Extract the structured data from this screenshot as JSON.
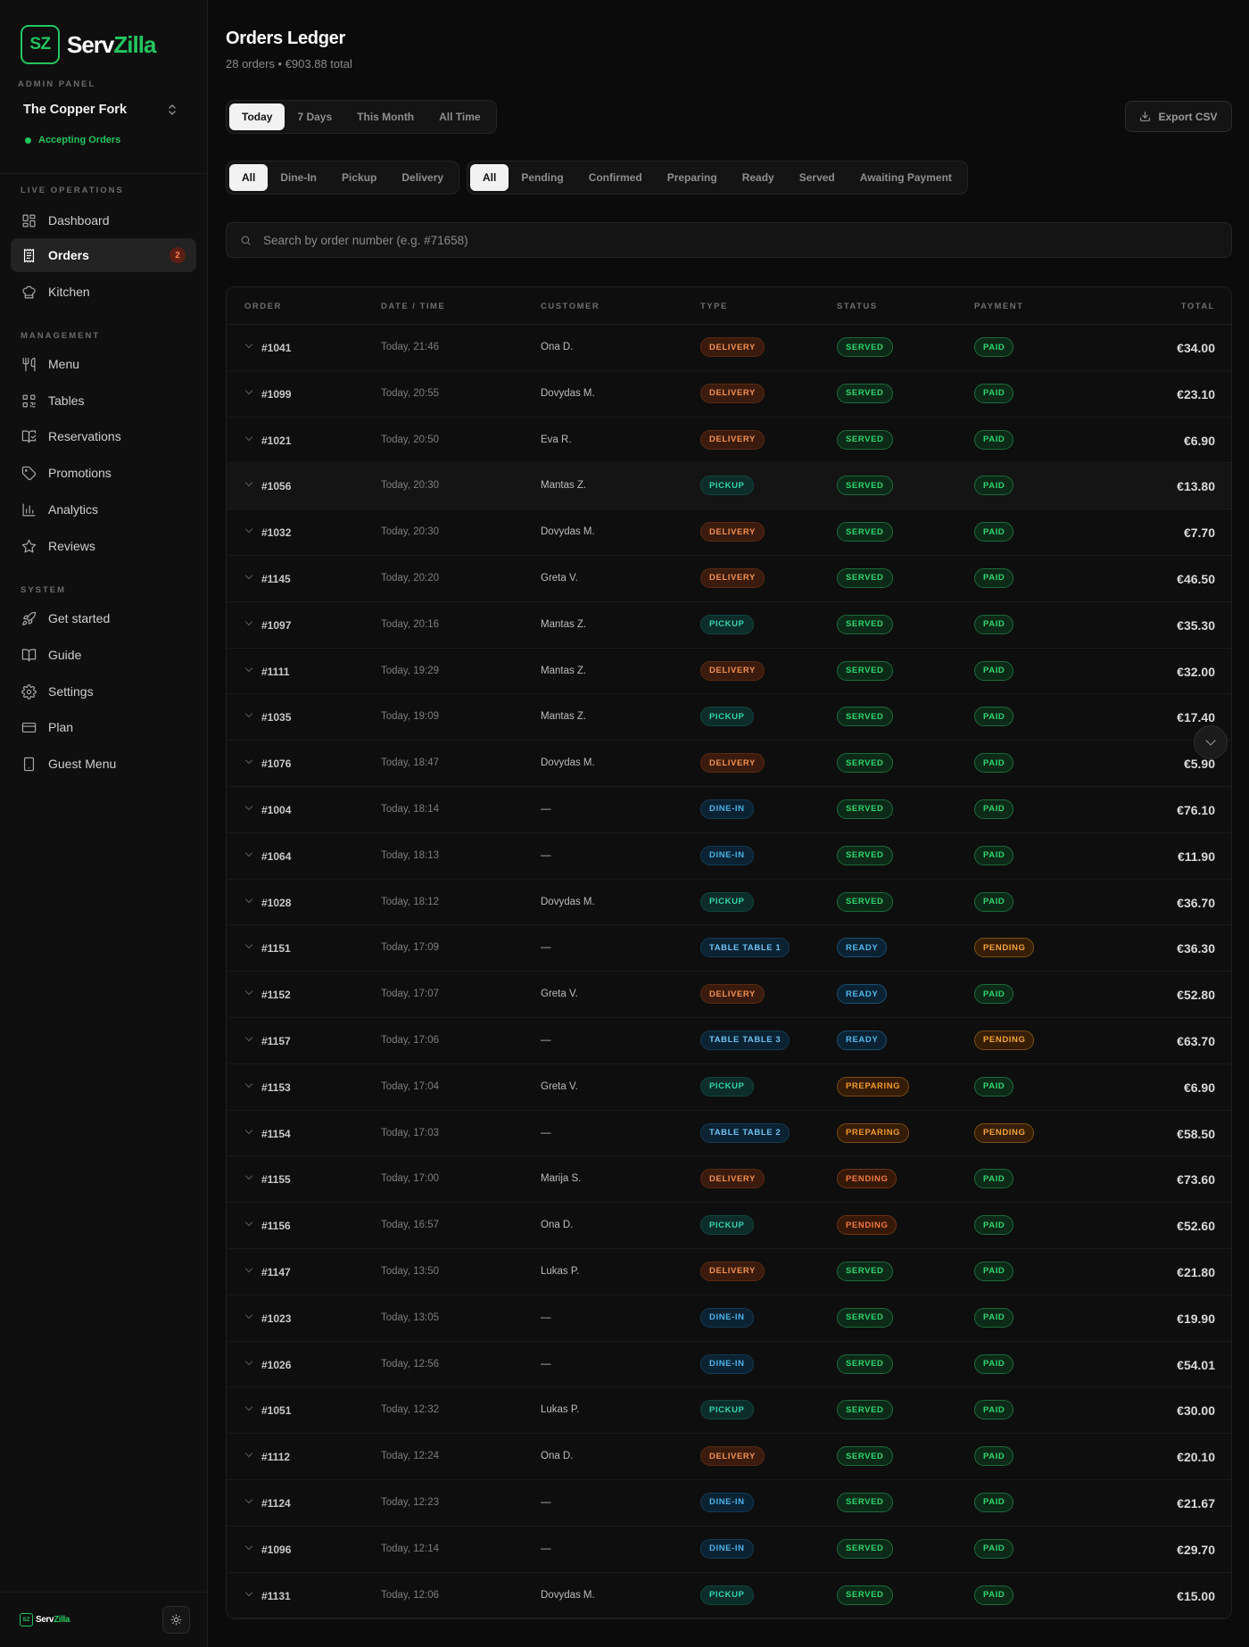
{
  "brand": {
    "mark": "SZ",
    "name_a": "Serv",
    "name_b": "Zilla"
  },
  "sidebar": {
    "admin_label": "ADMIN PANEL",
    "restaurant": "The Copper Fork",
    "status": "Accepting Orders",
    "sections": {
      "live": "LIVE OPERATIONS",
      "management": "MANAGEMENT",
      "system": "SYSTEM"
    },
    "items": {
      "dashboard": "Dashboard",
      "orders": "Orders",
      "orders_badge": "2",
      "kitchen": "Kitchen",
      "menu": "Menu",
      "tables": "Tables",
      "reservations": "Reservations",
      "promotions": "Promotions",
      "analytics": "Analytics",
      "reviews": "Reviews",
      "get_started": "Get started",
      "guide": "Guide",
      "settings": "Settings",
      "plan": "Plan",
      "guest_menu": "Guest Menu"
    }
  },
  "header": {
    "title": "Orders Ledger",
    "subtitle": "28 orders • €903.88 total"
  },
  "filters": {
    "range": [
      "Today",
      "7 Days",
      "This Month",
      "All Time"
    ],
    "range_selected": "Today",
    "type": [
      "All",
      "Dine-In",
      "Pickup",
      "Delivery"
    ],
    "type_selected": "All",
    "status": [
      "All",
      "Pending",
      "Confirmed",
      "Preparing",
      "Ready",
      "Served",
      "Awaiting Payment"
    ],
    "status_selected": "All"
  },
  "export_label": "Export CSV",
  "search": {
    "placeholder": "Search by order number (e.g. #71658)"
  },
  "table": {
    "columns": [
      "ORDER",
      "DATE / TIME",
      "CUSTOMER",
      "TYPE",
      "STATUS",
      "PAYMENT",
      "TOTAL"
    ],
    "rows": [
      {
        "order": "#1041",
        "time": "Today, 21:46",
        "customer": "Ona D.",
        "type": "DELIVERY",
        "status": "SERVED",
        "payment": "PAID",
        "total": "€34.00"
      },
      {
        "order": "#1099",
        "time": "Today, 20:55",
        "customer": "Dovydas M.",
        "type": "DELIVERY",
        "status": "SERVED",
        "payment": "PAID",
        "total": "€23.10"
      },
      {
        "order": "#1021",
        "time": "Today, 20:50",
        "customer": "Eva R.",
        "type": "DELIVERY",
        "status": "SERVED",
        "payment": "PAID",
        "total": "€6.90"
      },
      {
        "order": "#1056",
        "time": "Today, 20:30",
        "customer": "Mantas Z.",
        "type": "PICKUP",
        "status": "SERVED",
        "payment": "PAID",
        "total": "€13.80"
      },
      {
        "order": "#1032",
        "time": "Today, 20:30",
        "customer": "Dovydas M.",
        "type": "DELIVERY",
        "status": "SERVED",
        "payment": "PAID",
        "total": "€7.70"
      },
      {
        "order": "#1145",
        "time": "Today, 20:20",
        "customer": "Greta V.",
        "type": "DELIVERY",
        "status": "SERVED",
        "payment": "PAID",
        "total": "€46.50"
      },
      {
        "order": "#1097",
        "time": "Today, 20:16",
        "customer": "Mantas Z.",
        "type": "PICKUP",
        "status": "SERVED",
        "payment": "PAID",
        "total": "€35.30"
      },
      {
        "order": "#1111",
        "time": "Today, 19:29",
        "customer": "Mantas Z.",
        "type": "DELIVERY",
        "status": "SERVED",
        "payment": "PAID",
        "total": "€32.00"
      },
      {
        "order": "#1035",
        "time": "Today, 19:09",
        "customer": "Mantas Z.",
        "type": "PICKUP",
        "status": "SERVED",
        "payment": "PAID",
        "total": "€17.40"
      },
      {
        "order": "#1076",
        "time": "Today, 18:47",
        "customer": "Dovydas M.",
        "type": "DELIVERY",
        "status": "SERVED",
        "payment": "PAID",
        "total": "€5.90"
      },
      {
        "order": "#1004",
        "time": "Today, 18:14",
        "customer": "—",
        "type": "DINE-IN",
        "status": "SERVED",
        "payment": "PAID",
        "total": "€76.10"
      },
      {
        "order": "#1064",
        "time": "Today, 18:13",
        "customer": "—",
        "type": "DINE-IN",
        "status": "SERVED",
        "payment": "PAID",
        "total": "€11.90"
      },
      {
        "order": "#1028",
        "time": "Today, 18:12",
        "customer": "Dovydas M.",
        "type": "PICKUP",
        "status": "SERVED",
        "payment": "PAID",
        "total": "€36.70"
      },
      {
        "order": "#1151",
        "time": "Today, 17:09",
        "customer": "—",
        "type": "TABLE TABLE 1",
        "status": "READY",
        "payment": "PENDING",
        "total": "€36.30"
      },
      {
        "order": "#1152",
        "time": "Today, 17:07",
        "customer": "Greta V.",
        "type": "DELIVERY",
        "status": "READY",
        "payment": "PAID",
        "total": "€52.80"
      },
      {
        "order": "#1157",
        "time": "Today, 17:06",
        "customer": "—",
        "type": "TABLE TABLE 3",
        "status": "READY",
        "payment": "PENDING",
        "total": "€63.70"
      },
      {
        "order": "#1153",
        "time": "Today, 17:04",
        "customer": "Greta V.",
        "type": "PICKUP",
        "status": "PREPARING",
        "payment": "PAID",
        "total": "€6.90"
      },
      {
        "order": "#1154",
        "time": "Today, 17:03",
        "customer": "—",
        "type": "TABLE TABLE 2",
        "status": "PREPARING",
        "payment": "PENDING",
        "total": "€58.50"
      },
      {
        "order": "#1155",
        "time": "Today, 17:00",
        "customer": "Marija S.",
        "type": "DELIVERY",
        "status": "PENDING",
        "payment": "PAID",
        "total": "€73.60"
      },
      {
        "order": "#1156",
        "time": "Today, 16:57",
        "customer": "Ona D.",
        "type": "PICKUP",
        "status": "PENDING",
        "payment": "PAID",
        "total": "€52.60"
      },
      {
        "order": "#1147",
        "time": "Today, 13:50",
        "customer": "Lukas P.",
        "type": "DELIVERY",
        "status": "SERVED",
        "payment": "PAID",
        "total": "€21.80"
      },
      {
        "order": "#1023",
        "time": "Today, 13:05",
        "customer": "—",
        "type": "DINE-IN",
        "status": "SERVED",
        "payment": "PAID",
        "total": "€19.90"
      },
      {
        "order": "#1026",
        "time": "Today, 12:56",
        "customer": "—",
        "type": "DINE-IN",
        "status": "SERVED",
        "payment": "PAID",
        "total": "€54.01"
      },
      {
        "order": "#1051",
        "time": "Today, 12:32",
        "customer": "Lukas P.",
        "type": "PICKUP",
        "status": "SERVED",
        "payment": "PAID",
        "total": "€30.00"
      },
      {
        "order": "#1112",
        "time": "Today, 12:24",
        "customer": "Ona D.",
        "type": "DELIVERY",
        "status": "SERVED",
        "payment": "PAID",
        "total": "€20.10"
      },
      {
        "order": "#1124",
        "time": "Today, 12:23",
        "customer": "—",
        "type": "DINE-IN",
        "status": "SERVED",
        "payment": "PAID",
        "total": "€21.67"
      },
      {
        "order": "#1096",
        "time": "Today, 12:14",
        "customer": "—",
        "type": "DINE-IN",
        "status": "SERVED",
        "payment": "PAID",
        "total": "€29.70"
      },
      {
        "order": "#1131",
        "time": "Today, 12:06",
        "customer": "Dovydas M.",
        "type": "PICKUP",
        "status": "SERVED",
        "payment": "PAID",
        "total": "€15.00"
      }
    ]
  },
  "colors": {
    "accent": "#22c55e",
    "background": "#0b0b0b"
  }
}
